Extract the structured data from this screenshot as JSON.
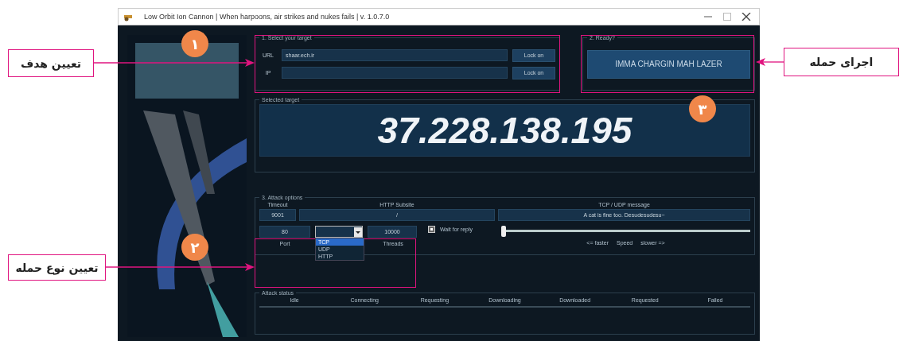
{
  "window": {
    "title": "Low Orbit Ion Cannon | When harpoons, air strikes and nukes fails | v. 1.0.7.0"
  },
  "target": {
    "legend": "1. Select your target",
    "fields": [
      {
        "label": "URL",
        "value": "shaar.ech.ir",
        "button": "Lock on"
      },
      {
        "label": "IP",
        "button": "Lock on"
      }
    ]
  },
  "ready": {
    "legend": "2. Ready?",
    "button": "IMMA CHARGIN MAH LAZER"
  },
  "selected_target": {
    "legend": "Selected target",
    "value": "37.228.138.195"
  },
  "attack_options": {
    "legend": "3. Attack options",
    "columns": [
      {
        "label": "Timeout",
        "value": "9001"
      },
      {
        "label": "HTTP Subsite",
        "value": "/"
      },
      {
        "label": "TCP / UDP message",
        "value": "A cat is fine too. Desudesudesu~"
      }
    ],
    "port": {
      "label": "Port",
      "value": "80"
    },
    "method": {
      "options": [
        {
          "label": "TCP",
          "selected": true
        },
        {
          "label": "UDP",
          "selected": false
        },
        {
          "label": "HTTP",
          "selected": false
        }
      ]
    },
    "threads": {
      "label": "Threads",
      "value": "10000"
    },
    "wait_for_reply": {
      "label": "Wait for reply",
      "checked": true
    },
    "speed": {
      "level": 0,
      "labels": [
        "<= faster",
        "Speed",
        "slower =>"
      ]
    }
  },
  "attack_status": {
    "legend": "Attack status",
    "columns": [
      "Idle",
      "Connecting",
      "Requesting",
      "Downloading",
      "Downloaded",
      "Requested",
      "Failed"
    ]
  },
  "callouts": [
    {
      "label": "تعیین هدف",
      "badge": "۱"
    },
    {
      "label": "تعیین نوع حمله",
      "badge": "۲"
    },
    {
      "label": "اجرای حمله",
      "badge": "۳"
    }
  ]
}
